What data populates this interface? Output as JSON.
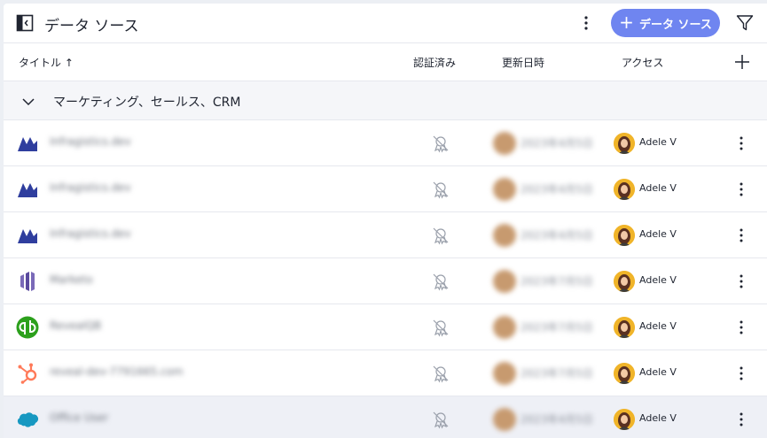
{
  "header": {
    "title": "データ ソース",
    "add_button_label": "データ ソース"
  },
  "columns": {
    "title": "タイトル ↑",
    "verified": "認証済み",
    "updated": "更新日時",
    "access": "アクセス"
  },
  "group": {
    "label": "マーケティング、セールス、CRM"
  },
  "rows": [
    {
      "logo": "dynamics-logo-icon",
      "name": "Infragistics.dev",
      "updated": "2023年4月5日",
      "access": "Adele V"
    },
    {
      "logo": "dynamics-logo-icon",
      "name": "Infragistics.dev",
      "updated": "2023年4月5日",
      "access": "Adele V"
    },
    {
      "logo": "dynamics-logo-icon",
      "name": "Infragistics.dev",
      "updated": "2023年4月5日",
      "access": "Adele V"
    },
    {
      "logo": "marketo-logo-icon",
      "name": "Marketo",
      "updated": "2023年7月5日",
      "access": "Adele V"
    },
    {
      "logo": "quickbooks-logo-icon",
      "name": "ReveaIQB",
      "updated": "2023年7月5日",
      "access": "Adele V"
    },
    {
      "logo": "hubspot-logo-icon",
      "name": "reveal-dev-7791665.com",
      "updated": "2023年7月5日",
      "access": "Adele V"
    },
    {
      "logo": "salesforce-logo-icon",
      "name": "Office User",
      "updated": "2023年4月5日",
      "access": "Adele V"
    }
  ],
  "colors": {
    "accent": "#6f85f0",
    "dynamics": "#2f3e9e",
    "marketo": "#5a4a9e",
    "quickbooks": "#2ca01c",
    "hubspot": "#ff7a59",
    "salesforce": "#1798c1"
  }
}
